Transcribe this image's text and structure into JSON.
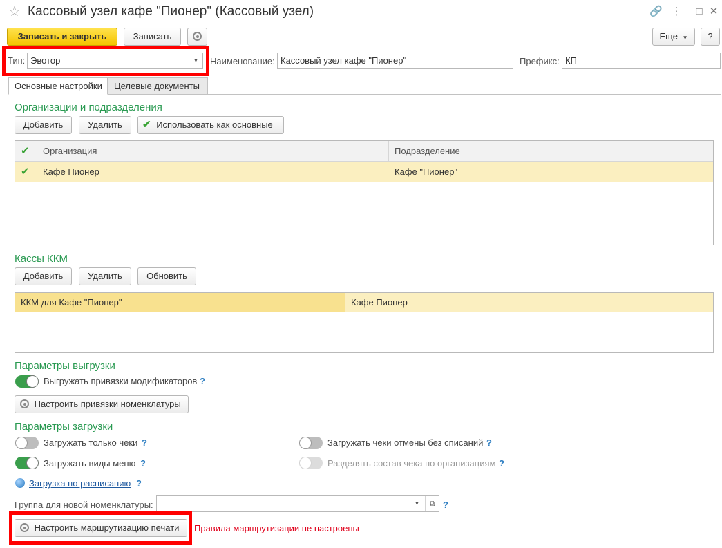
{
  "window": {
    "title": "Кассовый узел кафе \"Пионер\" (Кассовый узел)",
    "icons": [
      "star-icon",
      "link-icon",
      "more-icon",
      "maximize-icon",
      "close-icon"
    ]
  },
  "toolbar": {
    "save_close": "Записать и закрыть",
    "save": "Записать",
    "more": "Еще",
    "help": "?"
  },
  "header": {
    "type_label": "Тип:",
    "type_value": "Эвотор",
    "name_label": "Наименование:",
    "name_value": "Кассовый узел кафе \"Пионер\"",
    "prefix_label": "Префикс:",
    "prefix_value": "КП"
  },
  "tabs": [
    {
      "label": "Основные настройки",
      "active": true
    },
    {
      "label": "Целевые документы",
      "active": false
    }
  ],
  "orgs": {
    "title": "Организации и подразделения",
    "add": "Добавить",
    "delete": "Удалить",
    "use_main": "Использовать как основные",
    "columns": [
      "Организация",
      "Подразделение"
    ],
    "rows": [
      {
        "checked": true,
        "org": "Кафе Пионер",
        "dept": "Кафе \"Пионер\""
      }
    ]
  },
  "kkm": {
    "title": "Кассы ККМ",
    "add": "Добавить",
    "delete": "Удалить",
    "refresh": "Обновить",
    "rows": [
      {
        "name": "ККМ для Кафе \"Пионер\"",
        "org": "Кафе Пионер"
      }
    ]
  },
  "export": {
    "title": "Параметры выгрузки",
    "toggle_label": "Выгружать привязки модификаторов",
    "toggle_on": true,
    "setup_button": "Настроить привязки номенклатуры"
  },
  "import": {
    "title": "Параметры загрузки",
    "only_checks": "Загружать только чеки",
    "only_checks_on": false,
    "menu_types": "Загружать виды меню",
    "menu_types_on": true,
    "cancel_checks": "Загружать чеки отмены без списаний",
    "cancel_checks_on": false,
    "split_by_org": "Разделять состав чека по организациям",
    "split_by_org_on": false,
    "schedule_link": "Загрузка по расписанию",
    "group_label": "Группа для новой номенклатуры:",
    "group_value": ""
  },
  "routing": {
    "button": "Настроить маршрутизацию печати",
    "error": "Правила маршрутизации не настроены"
  },
  "help_mark": "?",
  "colors": {
    "accent_green": "#2a9a52",
    "primary_yellow": "#f5c400",
    "highlight_red": "#ff0000",
    "error_red": "#e0001b",
    "selected_row": "#fbefc0"
  }
}
